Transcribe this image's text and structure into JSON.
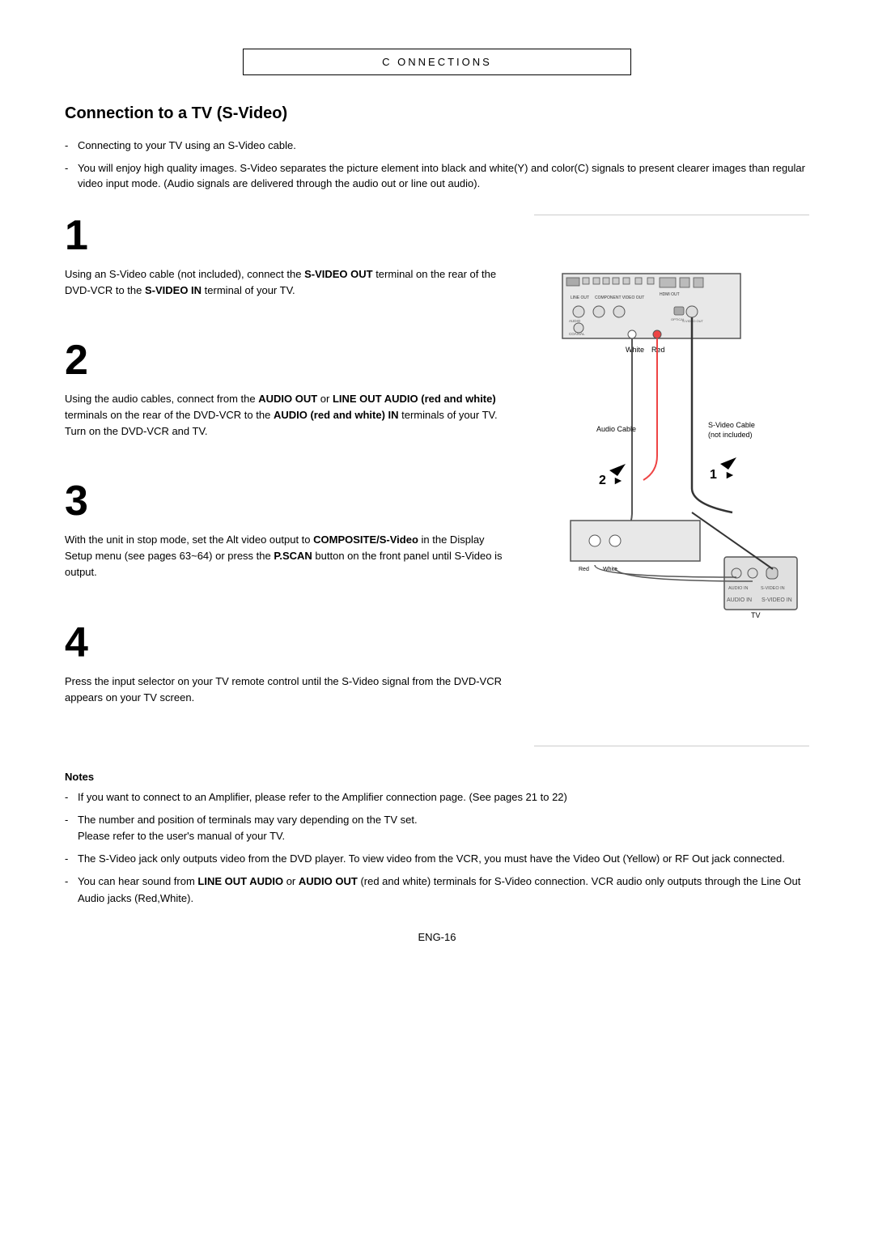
{
  "header": {
    "title": "C ONNECTIONS"
  },
  "section": {
    "title": "Connection to a TV (S-Video)"
  },
  "intro": {
    "items": [
      "Connecting to your TV using an S-Video cable.",
      "You will enjoy high quality images. S-Video separates the picture element into black and white(Y) and color(C) signals to present clearer images than regular video input mode. (Audio signals are delivered through the audio out or line out audio)."
    ]
  },
  "steps": [
    {
      "number": "1",
      "text_parts": [
        {
          "text": "Using an S-Video cable (not included), connect the "
        },
        {
          "text": "S-VIDEO OUT",
          "bold": true
        },
        {
          "text": " terminal on the rear of the DVD-VCR to the "
        },
        {
          "text": "S-VIDEO IN",
          "bold": true
        },
        {
          "text": " terminal of your TV."
        }
      ]
    },
    {
      "number": "2",
      "text_parts": [
        {
          "text": "Using the audio cables, connect from the "
        },
        {
          "text": "AUDIO OUT",
          "bold": true
        },
        {
          "text": " or "
        },
        {
          "text": "LINE OUT AUDIO (red and white)",
          "bold": true
        },
        {
          "text": " terminals on the rear of the DVD-VCR to the "
        },
        {
          "text": "AUDIO (red and white) IN",
          "bold": true
        },
        {
          "text": " terminals of your TV."
        },
        {
          "text": "\nTurn on the DVD-VCR and TV.",
          "newline": true
        }
      ]
    },
    {
      "number": "3",
      "text_parts": [
        {
          "text": "With the unit in stop mode, set the Alt video output to "
        },
        {
          "text": "COMPOSITE/S-Video",
          "bold": true
        },
        {
          "text": " in the Display Setup menu (see pages 63~64) or press the "
        },
        {
          "text": "P.SCAN",
          "bold": true
        },
        {
          "text": " button on the front panel until S-Video is output."
        }
      ]
    },
    {
      "number": "4",
      "text_parts": [
        {
          "text": "Press the input selector on your TV remote control until the S-Video signal from the DVD-VCR appears on your TV screen."
        }
      ]
    }
  ],
  "notes": {
    "title": "Notes",
    "items": [
      "If you want to connect to an Amplifier, please refer to the Amplifier connection page. (See pages 21 to 22)",
      "The number and position of terminals may vary depending on the TV set.\nPlease refer to the user's manual of your TV.",
      "The S-Video jack only outputs video from the DVD player. To view video from the VCR, you must have the Video Out (Yellow) or RF Out jack connected.",
      "You can hear sound from LINE OUT AUDIO or AUDIO OUT (red and white) terminals for S-Video connection. VCR audio only outputs through the Line Out Audio jacks (Red,White)."
    ]
  },
  "page_number": "ENG-16",
  "diagram": {
    "white_label": "White",
    "red_label": "Red",
    "audio_cable_label": "Audio Cable",
    "s_video_cable_label": "S-Video Cable\n(not included)",
    "red_bottom_label": "Red",
    "white_bottom_label": "White",
    "audio_in_label": "AUDIO IN",
    "s_video_in_label": "S-VIDEO IN",
    "tv_label": "TV",
    "step1_arrow": "1",
    "step2_arrow": "2"
  }
}
